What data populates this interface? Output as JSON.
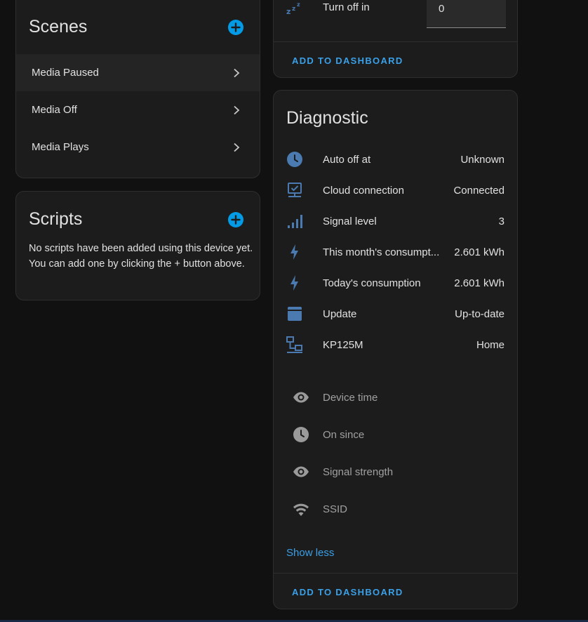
{
  "scenes": {
    "title": "Scenes",
    "items": [
      {
        "label": "Media Paused"
      },
      {
        "label": "Media Off"
      },
      {
        "label": "Media Plays"
      }
    ]
  },
  "scripts": {
    "title": "Scripts",
    "empty_text": "No scripts have been added using this device yet. You can add one by clicking the + button above."
  },
  "top_card": {
    "turn_off_label": "Turn off in",
    "turn_off_value": "0",
    "add_to_dashboard": "ADD TO DASHBOARD"
  },
  "diagnostic": {
    "title": "Diagnostic",
    "rows": [
      {
        "label": "Auto off at",
        "value": "Unknown",
        "icon": "clock-icon"
      },
      {
        "label": "Cloud connection",
        "value": "Connected",
        "icon": "cloud-check-icon"
      },
      {
        "label": "Signal level",
        "value": "3",
        "icon": "signal-bars-icon"
      },
      {
        "label": "This month's consumpt...",
        "value": "2.601 kWh",
        "icon": "lightning-icon"
      },
      {
        "label": "Today's consumption",
        "value": "2.601 kWh",
        "icon": "lightning-icon"
      },
      {
        "label": "Update",
        "value": "Up-to-date",
        "icon": "package-icon"
      },
      {
        "label": "KP125M",
        "value": "Home",
        "icon": "lan-icon"
      }
    ],
    "hidden_rows": [
      {
        "label": "Device time",
        "icon": "eye-icon"
      },
      {
        "label": "On since",
        "icon": "clock-icon"
      },
      {
        "label": "Signal strength",
        "icon": "eye-icon"
      },
      {
        "label": "SSID",
        "icon": "wifi-icon"
      }
    ],
    "show_less": "Show less",
    "add_to_dashboard": "ADD TO DASHBOARD"
  },
  "colors": {
    "accent": "#3aa0e8",
    "entity_icon": "#4a7ab0",
    "hidden_icon": "#9a9a9a"
  }
}
